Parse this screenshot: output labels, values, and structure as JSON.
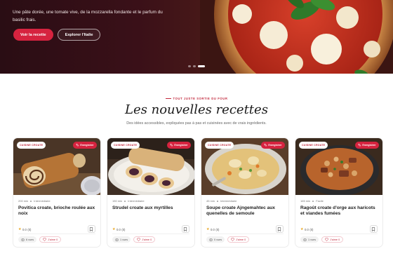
{
  "hero": {
    "text": "Une pâte dorée, une tomate vive, de la mozzarella fondante et le parfum du basilic frais.",
    "primary_button": "Voir la recette",
    "secondary_button": "Explorer l'Italie",
    "slides": 3,
    "active_slide": 3
  },
  "section": {
    "eyebrow": "TOUT JUSTE SORTIE DU FOUR",
    "title": "Les nouvelles recettes",
    "subtitle": "Des idées accessibles, expliquées pas à pas et cuisinées avec de vrais ingrédients."
  },
  "cards": [
    {
      "category": "CUISINE CROATE",
      "save_label": "Enregistrer",
      "time": "200 min",
      "difficulty": "Intermédiaire",
      "title": "Povitica croate, brioche roulée aux noix",
      "rating": "0.0",
      "rating_count": "(0)",
      "views": "6 vues",
      "likes": "J'aime 0"
    },
    {
      "category": "CUISINE CROATE",
      "save_label": "Enregistrer",
      "time": "150 min",
      "difficulty": "Intermédiaire",
      "title": "Strudel croate aux myrtilles",
      "rating": "0.0",
      "rating_count": "(0)",
      "views": "1 vues",
      "likes": "J'aime 0"
    },
    {
      "category": "CUISINE CROATE",
      "save_label": "Enregistrer",
      "time": "45 min",
      "difficulty": "Intermédiaire",
      "title": "Soupe croate Ajngemahtec aux quenelles de semoule",
      "rating": "0.0",
      "rating_count": "(0)",
      "views": "0 vues",
      "likes": "J'aime 0"
    },
    {
      "category": "CUISINE CROATE",
      "save_label": "Enregistrer",
      "time": "165 min",
      "difficulty": "Facile",
      "title": "Ragoût croate d'orge aux haricots et viandes fumées",
      "rating": "0.0",
      "rating_count": "(0)",
      "views": "1 vues",
      "likes": "J'aime 0"
    }
  ],
  "colors": {
    "accent": "#d6233f",
    "star": "#e8a317",
    "hero_bg": "#2a0d14"
  },
  "icons": {
    "save": "bookmark-icon",
    "views": "eye-icon",
    "likes": "heart-icon",
    "rating": "star-icon"
  }
}
